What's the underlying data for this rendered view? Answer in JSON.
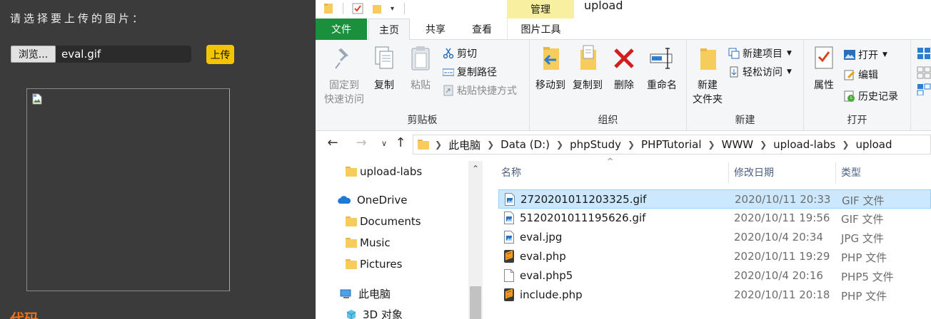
{
  "web": {
    "prompt": "请选择要上传的图片：",
    "browse_label": "浏览...",
    "file_name": "eval.gif",
    "upload_label": "上传",
    "code_heading": "代码"
  },
  "explorer": {
    "window_title": "upload",
    "context_tab": "管理",
    "tabs": [
      "文件",
      "主页",
      "共享",
      "查看",
      "图片工具"
    ],
    "clipboard": {
      "pin": [
        "固定到",
        "快速访问"
      ],
      "copy": "复制",
      "paste": "粘贴",
      "cut": "剪切",
      "copy_path": "复制路径",
      "paste_shortcut": "粘贴快捷方式",
      "label": "剪贴板"
    },
    "organize": {
      "move_to": "移动到",
      "copy_to": "复制到",
      "delete": "删除",
      "rename": "重命名",
      "label": "组织"
    },
    "new": {
      "new_folder": [
        "新建",
        "文件夹"
      ],
      "new_item": "新建项目",
      "easy_access": "轻松访问",
      "label": "新建"
    },
    "open": {
      "properties": "属性",
      "open": "打开",
      "edit": "编辑",
      "history": "历史记录",
      "label": "打开"
    },
    "breadcrumbs": [
      "此电脑",
      "Data (D:)",
      "phpStudy",
      "PHPTutorial",
      "WWW",
      "upload-labs",
      "upload"
    ],
    "nav_items": [
      {
        "label": "upload-labs",
        "icon": "folder-icon"
      },
      {
        "label": "OneDrive",
        "icon": "onedrive-icon"
      },
      {
        "label": "Documents",
        "icon": "folder-icon"
      },
      {
        "label": "Music",
        "icon": "folder-icon"
      },
      {
        "label": "Pictures",
        "icon": "folder-icon"
      },
      {
        "label": "此电脑",
        "icon": "computer-icon"
      },
      {
        "label": "3D 对象",
        "icon": "3d-objects-icon"
      }
    ],
    "columns": {
      "name": "名称",
      "date": "修改日期",
      "type": "类型"
    },
    "files": [
      {
        "name": "2720201011203325.gif",
        "date": "2020/10/11 20:33",
        "type": "GIF 文件",
        "icon": "image-file-icon",
        "selected": true
      },
      {
        "name": "5120201011195626.gif",
        "date": "2020/10/11 19:56",
        "type": "GIF 文件",
        "icon": "image-file-icon",
        "selected": false
      },
      {
        "name": "eval.jpg",
        "date": "2020/10/4 20:34",
        "type": "JPG 文件",
        "icon": "image-file-icon",
        "selected": false
      },
      {
        "name": "eval.php",
        "date": "2020/10/11 19:29",
        "type": "PHP 文件",
        "icon": "sublime-file-icon",
        "selected": false
      },
      {
        "name": "eval.php5",
        "date": "2020/10/4 20:16",
        "type": "PHP5 文件",
        "icon": "blank-file-icon",
        "selected": false
      },
      {
        "name": "include.php",
        "date": "2020/10/11 20:18",
        "type": "PHP 文件",
        "icon": "sublime-file-icon",
        "selected": false
      }
    ]
  }
}
